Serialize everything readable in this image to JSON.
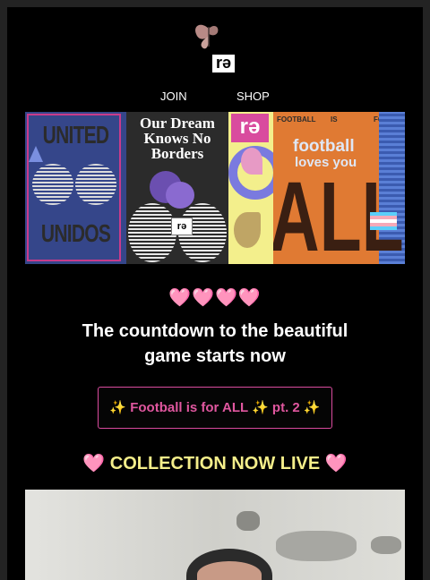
{
  "brand": {
    "logo_text": "rə"
  },
  "nav": {
    "items": [
      {
        "label": "JOIN"
      },
      {
        "label": "SHOP"
      }
    ]
  },
  "banner": {
    "panel1_line1": "UNITED",
    "panel1_line2": "UNIDOS",
    "panel2_text": "Our Dream Knows No Borders",
    "panel3_logo": "rə",
    "panel4_header_left": "FOOTBALL",
    "panel4_header_mid": "IS",
    "panel4_header_right": "FOR",
    "panel4_line1": "football",
    "panel4_line2": "loves you",
    "panel4_big": "ALL"
  },
  "hearts": "🩷🩷🩷🩷",
  "headline": {
    "line1": "The countdown to the beautiful",
    "line2": "game starts now"
  },
  "cta": {
    "label": "✨ Football is for ALL ✨ pt. 2 ✨"
  },
  "collection": {
    "label": "🩷 COLLECTION NOW LIVE 🩷"
  }
}
